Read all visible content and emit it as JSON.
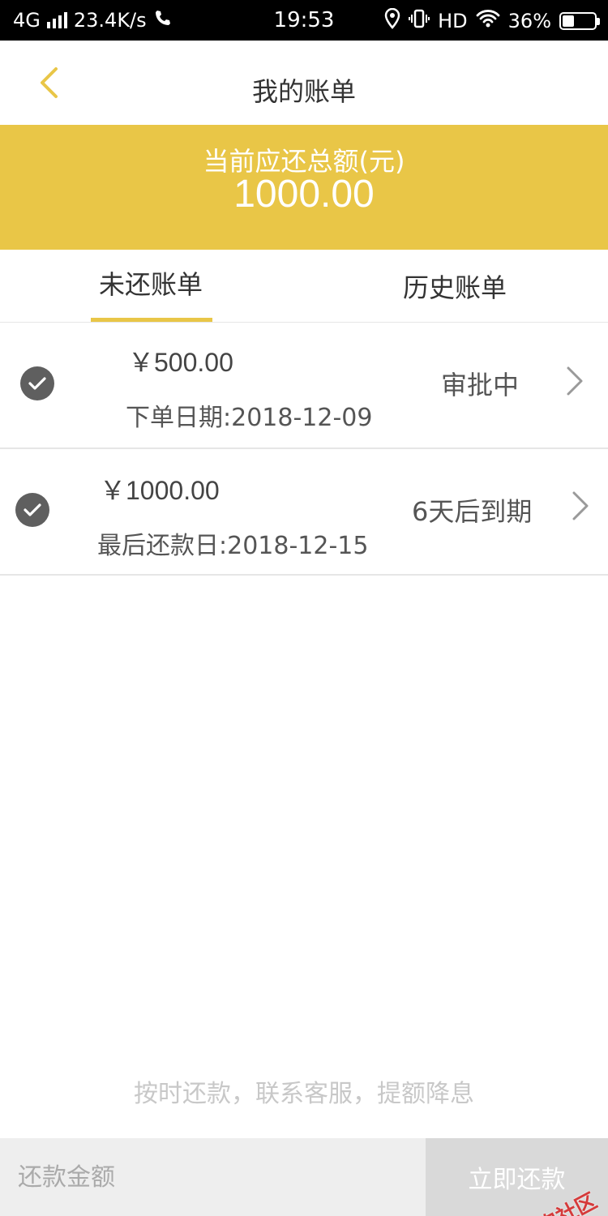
{
  "status_bar": {
    "network": "4G",
    "speed": "23.4K/s",
    "time": "19:53",
    "hd": "HD",
    "battery": "36%",
    "battery_level": 0.36
  },
  "header": {
    "title": "我的账单"
  },
  "summary": {
    "label": "当前应还总额(元)",
    "amount": "1000.00"
  },
  "tabs": [
    {
      "label": "未还账单",
      "active": true
    },
    {
      "label": "历史账单",
      "active": false
    }
  ],
  "bills": [
    {
      "amount": "￥500.00",
      "date": "下单日期:2018-12-09",
      "status": "审批中",
      "checked": true
    },
    {
      "amount": "￥1000.00",
      "date": "最后还款日:2018-12-15",
      "status": "6天后到期",
      "checked": true
    }
  ],
  "footer_note": "按时还款，联系客服，提额降息",
  "bottom": {
    "amount_placeholder": "还款金额",
    "pay_button": "立即还款"
  },
  "watermark": "卡农社区",
  "colors": {
    "accent": "#E9C647",
    "check": "#5f5f5f"
  }
}
